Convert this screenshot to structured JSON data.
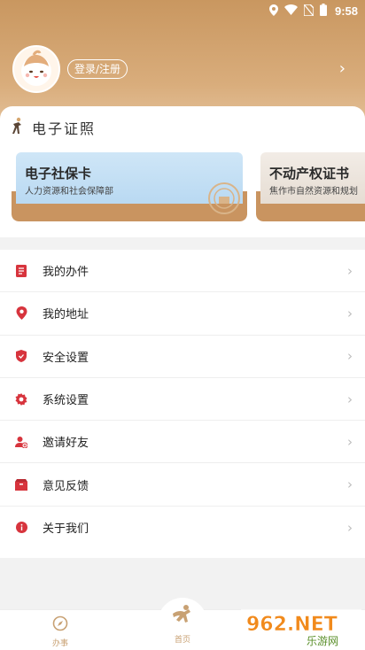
{
  "status_bar": {
    "time": "9:58"
  },
  "profile": {
    "login_label": "登录/注册"
  },
  "certificates": {
    "section_title": "电子证照",
    "cards": [
      {
        "name": "电子社保卡",
        "org": "人力资源和社会保障部"
      },
      {
        "name": "不动产权证书",
        "org": "焦作市自然资源和规划"
      }
    ]
  },
  "menu": {
    "items": [
      {
        "label": "我的办件",
        "icon": "document-icon"
      },
      {
        "label": "我的地址",
        "icon": "location-pin-icon"
      },
      {
        "label": "安全设置",
        "icon": "shield-icon"
      },
      {
        "label": "系统设置",
        "icon": "gear-icon"
      },
      {
        "label": "邀请好友",
        "icon": "add-user-icon"
      },
      {
        "label": "意见反馈",
        "icon": "feedback-box-icon"
      },
      {
        "label": "关于我们",
        "icon": "info-icon"
      }
    ]
  },
  "tabbar": {
    "tabs": [
      {
        "label": "办事",
        "icon": "compass-icon"
      },
      {
        "label": "首页",
        "icon": "home-mascot-icon"
      }
    ]
  },
  "watermark": {
    "text": "962.NET",
    "subtext": "乐游网"
  },
  "colors": {
    "accent": "#c8a173",
    "menu_icon": "#d7343d",
    "header_gradient_top": "#c99760"
  }
}
